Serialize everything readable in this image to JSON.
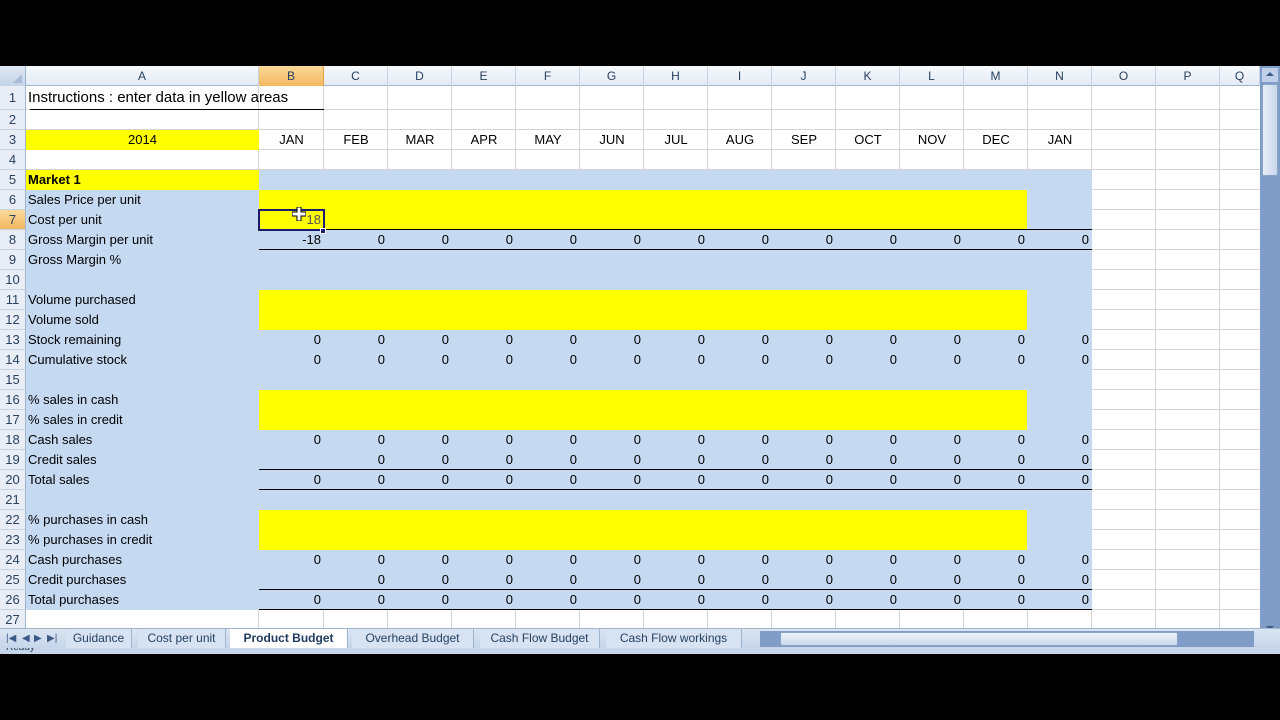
{
  "columns": [
    "A",
    "B",
    "C",
    "D",
    "E",
    "F",
    "G",
    "H",
    "I",
    "J",
    "K",
    "L",
    "M",
    "N",
    "O",
    "P",
    "Q"
  ],
  "selected_column": "B",
  "selected_row": 7,
  "rows": [
    "1",
    "2",
    "3",
    "4",
    "5",
    "6",
    "7",
    "8",
    "9",
    "10",
    "11",
    "12",
    "13",
    "14",
    "15",
    "16",
    "17",
    "18",
    "19",
    "20",
    "21",
    "22",
    "23",
    "24",
    "25",
    "26",
    "27"
  ],
  "title": "Instructions : enter data in yellow areas",
  "year": "2014",
  "months": [
    "JAN",
    "FEB",
    "MAR",
    "APR",
    "MAY",
    "JUN",
    "JUL",
    "AUG",
    "SEP",
    "OCT",
    "NOV",
    "DEC",
    "JAN"
  ],
  "section": "Market 1",
  "labels": {
    "r6": "Sales Price per unit",
    "r7": "Cost per unit",
    "r8": "Gross Margin per unit",
    "r9": "Gross Margin %",
    "r11": "Volume purchased",
    "r12": "Volume sold",
    "r13": "Stock remaining",
    "r14": "Cumulative stock",
    "r16": "% sales in cash",
    "r17": "% sales in credit",
    "r18": "Cash sales",
    "r19": "Credit sales",
    "r20": "Total sales",
    "r22": "% purchases in cash",
    "r23": "% purchases in credit",
    "r24": "Cash purchases",
    "r25": "Credit purchases",
    "r26": "Total purchases"
  },
  "values": {
    "r7": [
      "18",
      "",
      "",
      "",
      "",
      "",
      "",
      "",
      "",
      "",
      "",
      "",
      ""
    ],
    "r8": [
      "-18",
      "0",
      "0",
      "0",
      "0",
      "0",
      "0",
      "0",
      "0",
      "0",
      "0",
      "0",
      "0"
    ],
    "r13": [
      "0",
      "0",
      "0",
      "0",
      "0",
      "0",
      "0",
      "0",
      "0",
      "0",
      "0",
      "0",
      "0"
    ],
    "r14": [
      "0",
      "0",
      "0",
      "0",
      "0",
      "0",
      "0",
      "0",
      "0",
      "0",
      "0",
      "0",
      "0"
    ],
    "r18": [
      "0",
      "0",
      "0",
      "0",
      "0",
      "0",
      "0",
      "0",
      "0",
      "0",
      "0",
      "0",
      "0"
    ],
    "r19": [
      "",
      "0",
      "0",
      "0",
      "0",
      "0",
      "0",
      "0",
      "0",
      "0",
      "0",
      "0",
      "0"
    ],
    "r20": [
      "0",
      "0",
      "0",
      "0",
      "0",
      "0",
      "0",
      "0",
      "0",
      "0",
      "0",
      "0",
      "0"
    ],
    "r24": [
      "0",
      "0",
      "0",
      "0",
      "0",
      "0",
      "0",
      "0",
      "0",
      "0",
      "0",
      "0",
      "0"
    ],
    "r25": [
      "",
      "0",
      "0",
      "0",
      "0",
      "0",
      "0",
      "0",
      "0",
      "0",
      "0",
      "0",
      "0"
    ],
    "r26": [
      "0",
      "0",
      "0",
      "0",
      "0",
      "0",
      "0",
      "0",
      "0",
      "0",
      "0",
      "0",
      "0"
    ]
  },
  "sheet_tabs": [
    {
      "label": "Guidance",
      "active": false
    },
    {
      "label": "Cost per unit",
      "active": false
    },
    {
      "label": "Product Budget",
      "active": true
    },
    {
      "label": "Overhead Budget",
      "active": false
    },
    {
      "label": "Cash Flow Budget",
      "active": false
    },
    {
      "label": "Cash Flow workings",
      "active": false
    }
  ],
  "status_text": "Ready",
  "colors": {
    "input_fill": "#ffff00",
    "calc_fill": "#c5d9f1",
    "selection": "#1c1c6e"
  }
}
